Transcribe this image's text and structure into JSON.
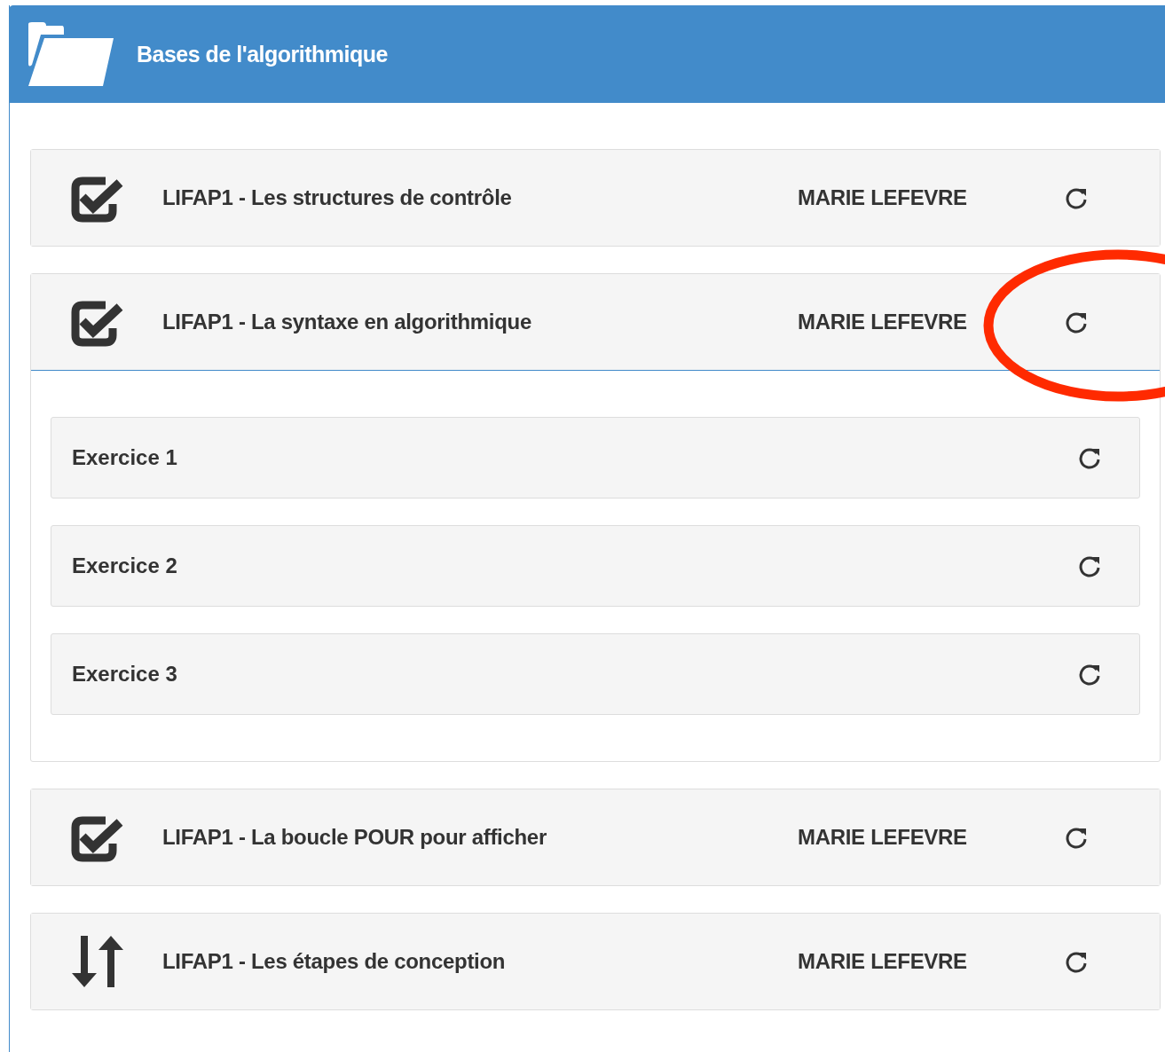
{
  "panel": {
    "title": "Bases de l'algorithmique"
  },
  "sections": [
    {
      "kind": "quiz",
      "name": "LIFAP1 - Les structures de contrôle",
      "author": "MARIE LEFEVRE",
      "expanded": false
    },
    {
      "kind": "quiz",
      "name": "LIFAP1 - La syntaxe en algorithmique",
      "author": "MARIE LEFEVRE",
      "expanded": true,
      "exercises": [
        {
          "name": "Exercice 1"
        },
        {
          "name": "Exercice 2"
        },
        {
          "name": "Exercice 3"
        }
      ]
    },
    {
      "kind": "quiz",
      "name": "LIFAP1 - La boucle POUR pour afficher",
      "author": "MARIE LEFEVRE",
      "expanded": false
    },
    {
      "kind": "sort",
      "name": "LIFAP1 - Les étapes de conception",
      "author": "MARIE LEFEVRE",
      "expanded": false
    }
  ],
  "annotation": {
    "kind": "ellipse"
  }
}
